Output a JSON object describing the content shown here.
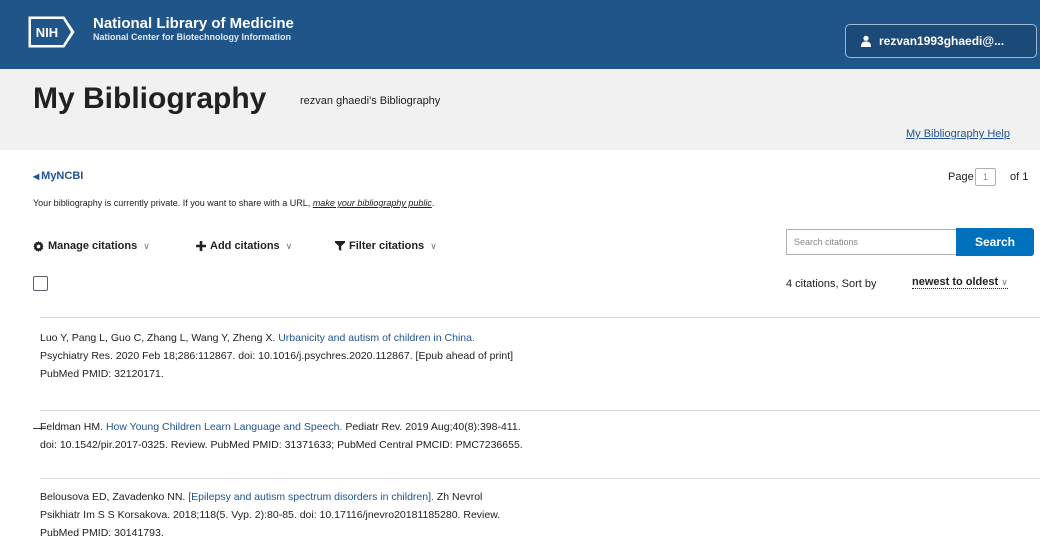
{
  "header": {
    "logo_text": "NIH",
    "org_title": "National Library of Medicine",
    "org_subtitle": "National Center for Biotechnology Information",
    "account_label": "rezvan1993ghaedi@..."
  },
  "bibliography": {
    "title": "My Bibliography",
    "owner": "rezvan ghaedi's Bibliography",
    "help_link": "My Bibliography Help"
  },
  "nav": {
    "back_link": "MyNCBI",
    "page_label": "Page",
    "page_value": "1",
    "page_of": "of 1"
  },
  "privacy": {
    "text": "Your bibliography is currently private. If you want to share with a URL, ",
    "link": "make your bibliography public",
    "suffix": "."
  },
  "toolbar": {
    "manage": "Manage citations",
    "add": "Add citations",
    "filter": "Filter citations",
    "search_placeholder": "Search citations",
    "search_button": "Search"
  },
  "list": {
    "count_label": "4 citations, Sort by",
    "sort_value": "newest to oldest",
    "citations": [
      {
        "authors": "Luo Y, Pang L, Guo C, Zhang L, Wang Y, Zheng X.",
        "title": "Urbanicity and autism of children in China.",
        "line2": "Psychiatry Res. 2020 Feb 18;286:112867. doi: 10.1016/j.psychres.2020.112867. [Epub ahead of print]",
        "line3": "PubMed PMID: 32120171."
      },
      {
        "authors": "Feldman HM.",
        "title": "How Young Children Learn Language and Speech.",
        "line1_rest": "Pediatr Rev. 2019 Aug;40(8):398-411.",
        "line2": "doi: 10.1542/pir.2017-0325. Review. PubMed PMID: 31371633; PubMed Central PMCID: PMC7236655."
      },
      {
        "authors": "Belousova ED, Zavadenko NN.",
        "title": "[Epilepsy and autism spectrum disorders in children].",
        "line1_rest": "Zh Nevrol",
        "line2": "Psikhiatr Im S S Korsakova. 2018;118(5. Vyp. 2):80-85. doi: 10.17116/jnevro20181185280. Review.",
        "line3": "PubMed PMID: 30141793."
      }
    ]
  },
  "colors": {
    "header_bg": "#20558a",
    "band_bg": "#f1f1f1",
    "link": "#205493",
    "search_button": "#0071bc"
  }
}
